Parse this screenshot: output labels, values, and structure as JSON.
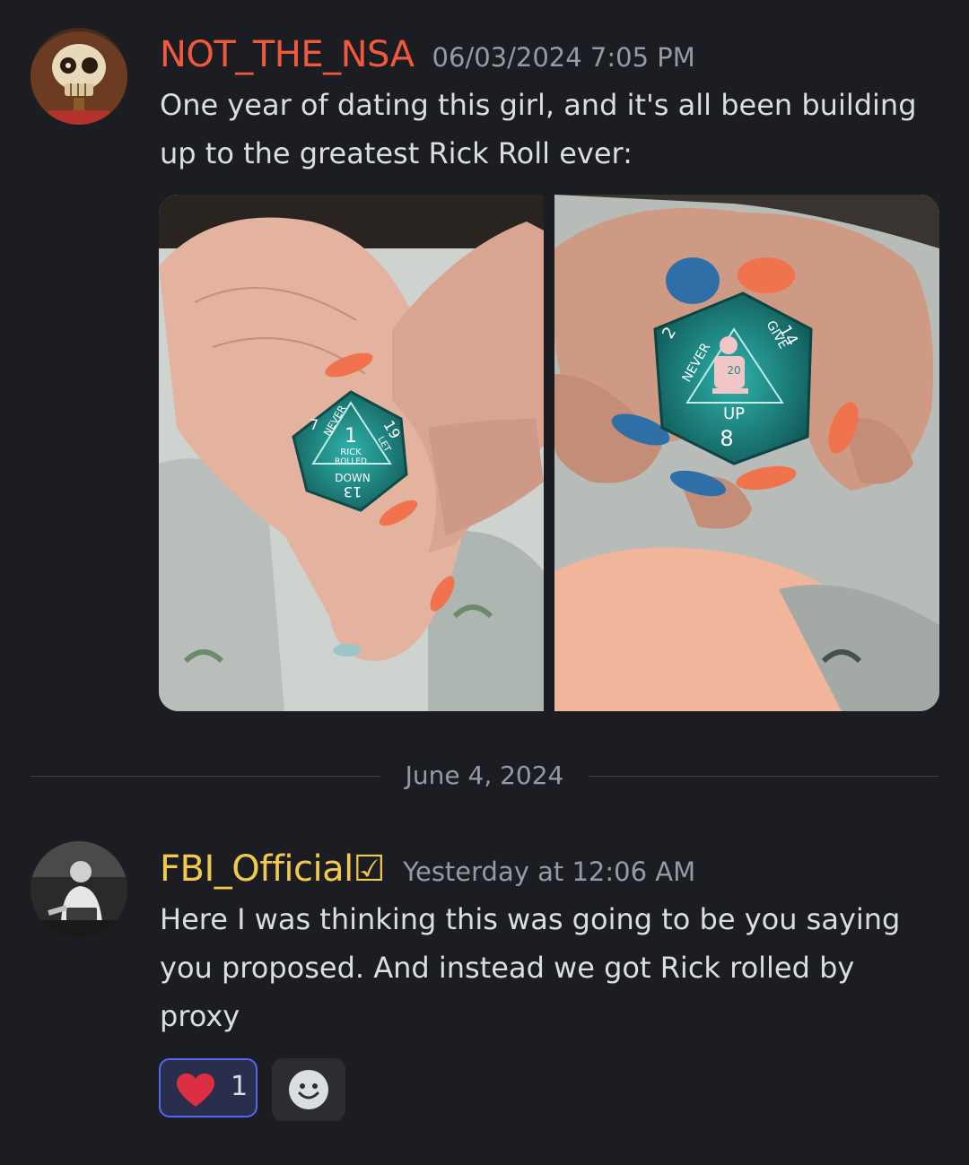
{
  "messages": [
    {
      "username": "NOT_THE_NSA",
      "username_color": "#f0593e",
      "timestamp": "06/03/2024 7:05 PM",
      "lines": [
        "One year of dating this girl, and it's all been building",
        "up to the greatest Rick Roll ever:"
      ],
      "attachments": [
        {
          "icon": "d20-in-palm-photo",
          "dice_text": [
            "NEVER",
            "1",
            "RICK",
            "ROLLED",
            "DOWN",
            "13",
            "7",
            "19",
            "LET"
          ]
        },
        {
          "icon": "d20-held-fingertips-photo",
          "dice_text": [
            "NEVER",
            "GIVE",
            "UP",
            "8",
            "20",
            "14",
            "2"
          ]
        }
      ]
    },
    {
      "username": "FBI_Official☑",
      "username_color": "#f2c94c",
      "timestamp": "Yesterday at 12:06 AM",
      "lines": [
        "Here I was thinking this was going to be you saying",
        "you proposed. And instead we got Rick rolled by",
        "proxy"
      ],
      "reactions": [
        {
          "emoji": "heart-icon",
          "count": "1",
          "active": true
        }
      ],
      "add_reaction_icon": "smiley-icon"
    }
  ],
  "date_divider": "June 4, 2024",
  "colors": {
    "background": "#1c1d22",
    "text": "#dbdee1",
    "muted": "#949ba4",
    "reaction_border": "#5865f2",
    "dice": "#1e8f8a"
  }
}
